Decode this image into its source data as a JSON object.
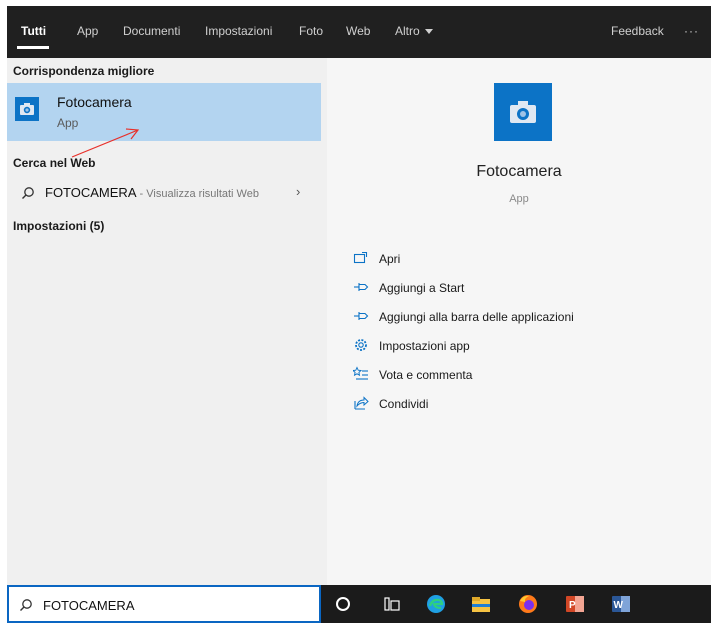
{
  "tabs": [
    {
      "label": "Tutti",
      "active": true
    },
    {
      "label": "App"
    },
    {
      "label": "Documenti"
    },
    {
      "label": "Impostazioni"
    },
    {
      "label": "Foto"
    },
    {
      "label": "Web"
    },
    {
      "label": "Altro"
    }
  ],
  "topbar": {
    "feedback": "Feedback",
    "more": "···"
  },
  "left": {
    "best_match_title": "Corrispondenza migliore",
    "best_match": {
      "name": "Fotocamera",
      "kind": "App",
      "icon": "camera-icon"
    },
    "web_title": "Cerca nel Web",
    "web_query": "FOTOCAMERA",
    "web_hint": " - Visualizza risultati Web",
    "settings_title": "Impostazioni (5)"
  },
  "right": {
    "name": "Fotocamera",
    "kind": "App",
    "actions": [
      {
        "label": "Apri",
        "icon": "open-icon"
      },
      {
        "label": "Aggiungi a Start",
        "icon": "pin-icon"
      },
      {
        "label": "Aggiungi alla barra delle applicazioni",
        "icon": "pin-icon"
      },
      {
        "label": "Impostazioni app",
        "icon": "gear-icon"
      },
      {
        "label": "Vota e commenta",
        "icon": "rate-icon"
      },
      {
        "label": "Condividi",
        "icon": "share-icon"
      }
    ]
  },
  "taskbar": {
    "search_value": "FOTOCAMERA",
    "items": [
      "cortana-icon",
      "task-view-icon",
      "edge-icon",
      "file-explorer-icon",
      "firefox-icon",
      "powerpoint-icon",
      "word-icon"
    ]
  },
  "colors": {
    "accent": "#0c73c6",
    "topbar": "#202020",
    "selected": "#b3d4f0",
    "arrow": "#e8302a"
  }
}
